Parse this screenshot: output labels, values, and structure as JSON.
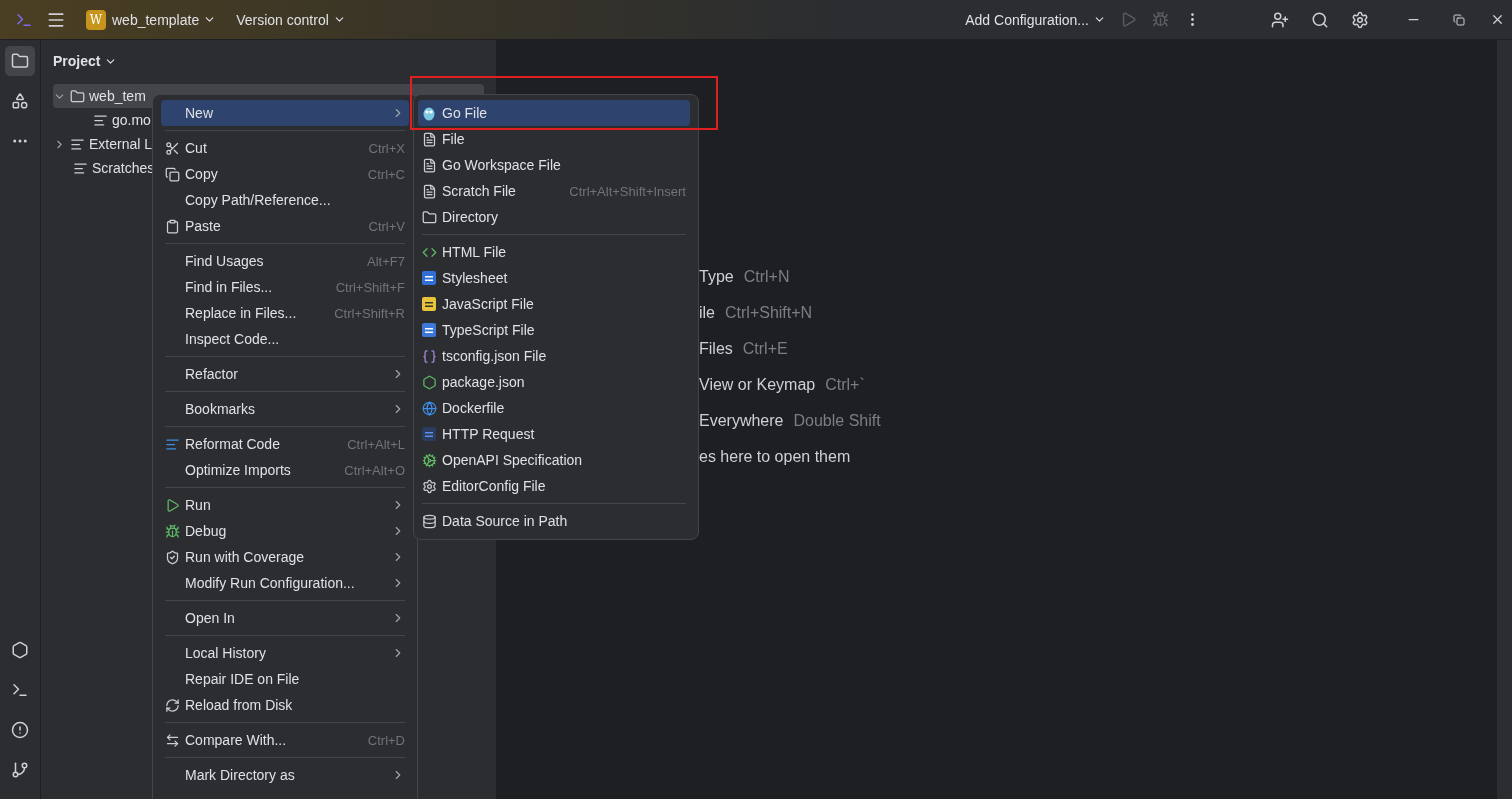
{
  "title_bar": {
    "project_badge": "W",
    "project": "web_template",
    "vcs": "Version control",
    "run_config": "Add Configuration..."
  },
  "project_panel": {
    "title": "Project",
    "tree": [
      {
        "label": "web_tem",
        "expanded": true,
        "selected": true,
        "children": [
          {
            "label": "go.mo",
            "selected": false
          }
        ]
      },
      {
        "label": "External L",
        "expanded": false,
        "selected": false
      },
      {
        "label": "Scratches",
        "selected": false
      }
    ]
  },
  "welcome": [
    {
      "text": "Type",
      "shortcut": "Ctrl+N"
    },
    {
      "text": "ile",
      "shortcut": "Ctrl+Shift+N"
    },
    {
      "text": "Files",
      "shortcut": "Ctrl+E"
    },
    {
      "text": "View or Keymap",
      "shortcut": "Ctrl+`"
    },
    {
      "text": "Everywhere",
      "shortcut": "Double Shift"
    },
    {
      "text": "es here to open them"
    }
  ],
  "context_menu": {
    "groups": [
      [
        {
          "label": "New",
          "submenu": true,
          "selected": true
        }
      ],
      [
        {
          "label": "Cut",
          "shortcut": "Ctrl+X",
          "selected": false
        },
        {
          "label": "Copy",
          "shortcut": "Ctrl+C",
          "selected": false
        },
        {
          "label": "Copy Path/Reference...",
          "selected": false
        },
        {
          "label": "Paste",
          "shortcut": "Ctrl+V",
          "selected": false
        }
      ],
      [
        {
          "label": "Find Usages",
          "shortcut": "Alt+F7",
          "selected": false
        },
        {
          "label": "Find in Files...",
          "shortcut": "Ctrl+Shift+F",
          "selected": false
        },
        {
          "label": "Replace in Files...",
          "shortcut": "Ctrl+Shift+R",
          "selected": false
        },
        {
          "label": "Inspect Code...",
          "selected": false
        }
      ],
      [
        {
          "label": "Refactor",
          "submenu": true,
          "selected": false
        }
      ],
      [
        {
          "label": "Bookmarks",
          "submenu": true,
          "selected": false
        }
      ],
      [
        {
          "label": "Reformat Code",
          "shortcut": "Ctrl+Alt+L",
          "selected": false
        },
        {
          "label": "Optimize Imports",
          "shortcut": "Ctrl+Alt+O",
          "selected": false
        }
      ],
      [
        {
          "label": "Run",
          "submenu": true,
          "selected": false
        },
        {
          "label": "Debug",
          "submenu": true,
          "selected": false
        },
        {
          "label": "Run with Coverage",
          "submenu": true,
          "selected": false
        },
        {
          "label": "Modify Run Configuration...",
          "submenu": true,
          "selected": false
        }
      ],
      [
        {
          "label": "Open In",
          "submenu": true,
          "selected": false
        }
      ],
      [
        {
          "label": "Local History",
          "submenu": true,
          "selected": false
        },
        {
          "label": "Repair IDE on File",
          "selected": false
        },
        {
          "label": "Reload from Disk",
          "selected": false
        }
      ],
      [
        {
          "label": "Compare With...",
          "shortcut": "Ctrl+D",
          "selected": false
        }
      ],
      [
        {
          "label": "Mark Directory as",
          "submenu": true,
          "selected": false
        }
      ]
    ]
  },
  "new_submenu": {
    "groups": [
      [
        {
          "label": "Go File",
          "selected": true
        },
        {
          "label": "File",
          "selected": false
        },
        {
          "label": "Go Workspace File",
          "selected": false
        },
        {
          "label": "Scratch File",
          "shortcut": "Ctrl+Alt+Shift+Insert",
          "selected": false
        },
        {
          "label": "Directory",
          "selected": false
        }
      ],
      [
        {
          "label": "HTML File",
          "selected": false
        },
        {
          "label": "Stylesheet",
          "selected": false
        },
        {
          "label": "JavaScript File",
          "selected": false
        },
        {
          "label": "TypeScript File",
          "selected": false
        },
        {
          "label": "tsconfig.json File",
          "selected": false
        },
        {
          "label": "package.json",
          "selected": false
        },
        {
          "label": "Dockerfile",
          "selected": false
        },
        {
          "label": "HTTP Request",
          "selected": false
        },
        {
          "label": "OpenAPI Specification",
          "selected": false
        },
        {
          "label": "EditorConfig File",
          "selected": false
        }
      ],
      [
        {
          "label": "Data Source in Path",
          "selected": false
        }
      ]
    ]
  }
}
